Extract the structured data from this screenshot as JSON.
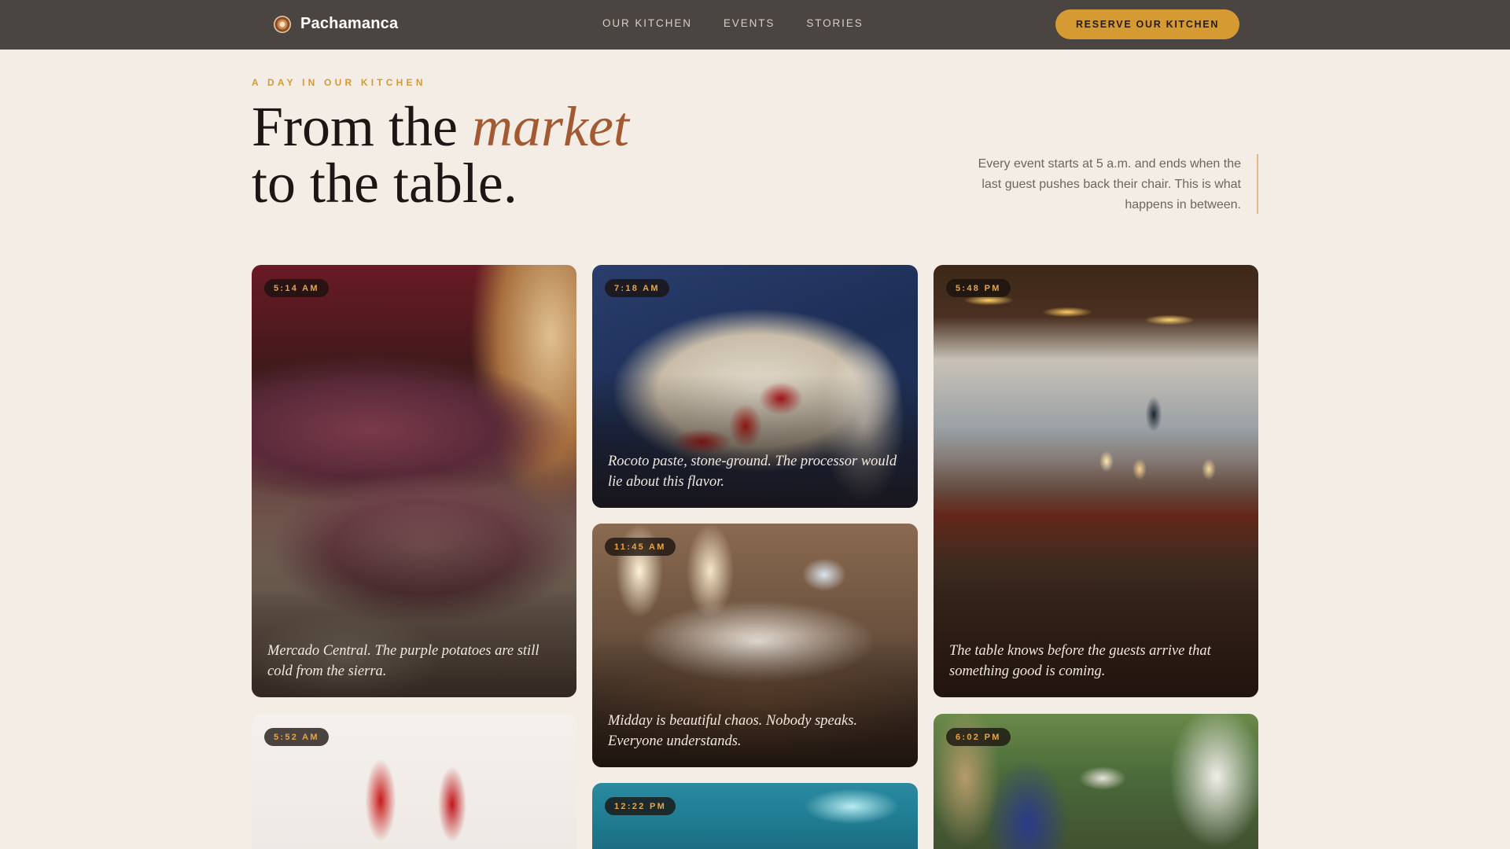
{
  "nav": {
    "brand": "Pachamanca",
    "links": [
      "OUR KITCHEN",
      "EVENTS",
      "STORIES"
    ],
    "cta": "RESERVE OUR KITCHEN"
  },
  "hero": {
    "eyebrow": "A DAY IN OUR KITCHEN",
    "title_part1": "From the ",
    "title_accent": "market",
    "title_line2": "to the table.",
    "description": "Every event starts at 5 a.m. and ends when the last guest pushes back their chair. This is what happens in between."
  },
  "cards": [
    {
      "time": "5:14 AM",
      "caption": "Mercado Central. The purple potatoes are still cold from the sierra."
    },
    {
      "time": "7:18 AM",
      "caption": "Rocoto paste, stone-ground. The processor would lie about this flavor."
    },
    {
      "time": "5:48 PM",
      "caption": "The table knows before the guests arrive that something good is coming."
    },
    {
      "time": "11:45 AM",
      "caption": "Midday is beautiful chaos. Nobody speaks. Everyone understands."
    },
    {
      "time": "5:52 AM",
      "caption": ""
    },
    {
      "time": "12:22 PM",
      "caption": ""
    },
    {
      "time": "6:02 PM",
      "caption": ""
    }
  ],
  "colors": {
    "background": "#f3ede6",
    "nav": "#4b4541",
    "accent_gold": "#d69a32",
    "accent_rust": "#a35a33"
  }
}
